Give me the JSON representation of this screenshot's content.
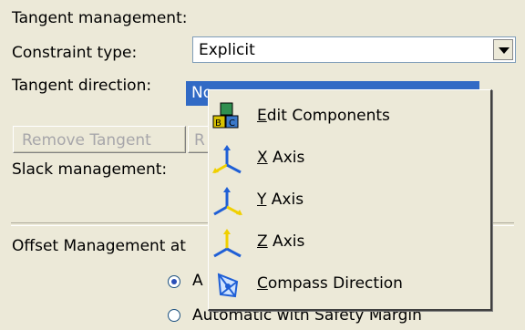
{
  "tangent_management": {
    "header": "Tangent management:",
    "constraint_type_label": "Constraint type:",
    "constraint_type_value": "Explicit",
    "tangent_direction_label": "Tangent direction:",
    "tangent_direction_value": "No",
    "remove_tangent_label": "Remove Tangent",
    "reverse_prefix": "R"
  },
  "slack_management": {
    "label": "Slack management:"
  },
  "offset_management": {
    "label": "Offset Management at",
    "options": [
      {
        "label": "A",
        "selected": true
      },
      {
        "label": "Automatic with Safety Margin",
        "selected": false
      }
    ]
  },
  "context_menu": {
    "items": [
      {
        "mnemonic": "E",
        "rest": "dit Components",
        "icon": "edit-components-icon"
      },
      {
        "mnemonic": "X",
        "rest": " Axis",
        "icon": "x-axis-icon"
      },
      {
        "mnemonic": "Y",
        "rest": " Axis",
        "icon": "y-axis-icon"
      },
      {
        "mnemonic": "Z",
        "rest": " Axis",
        "icon": "z-axis-icon"
      },
      {
        "mnemonic": "C",
        "rest": "ompass Direction",
        "icon": "compass-direction-icon"
      }
    ]
  },
  "colors": {
    "selection": "#316ac5",
    "panel": "#ece9d8",
    "axis_yellow": "#f0d000",
    "axis_blue": "#1f5fd6"
  }
}
